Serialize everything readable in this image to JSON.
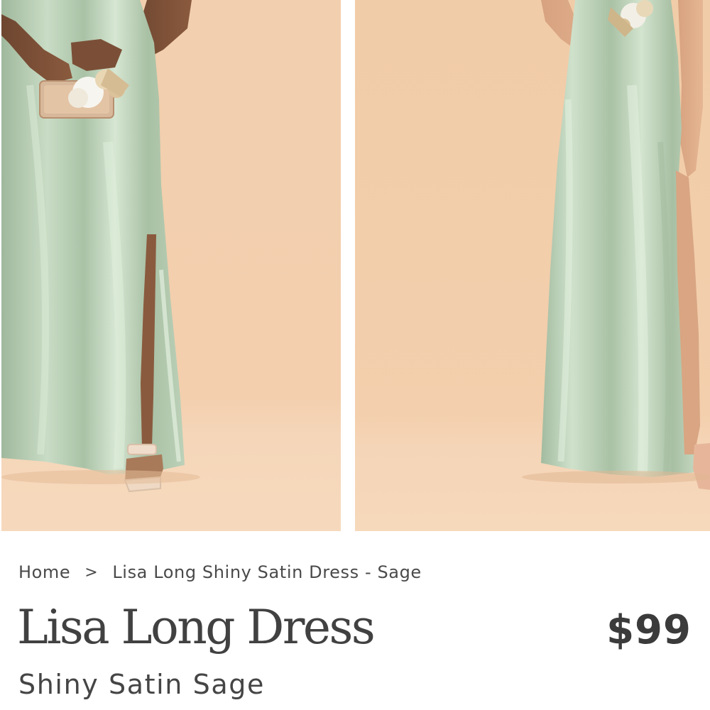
{
  "gallery": {
    "images": [
      {
        "alt": "Model wearing Lisa Long Dress in sage satin holding a clutch and flowers"
      },
      {
        "alt": "Model wearing Lisa Long Dress in sage satin with side slit"
      }
    ]
  },
  "breadcrumb": {
    "home": "Home",
    "separator": ">",
    "current": "Lisa Long Shiny Satin Dress - Sage"
  },
  "product": {
    "title": "Lisa Long Dress",
    "price": "$99",
    "variant": "Shiny Satin Sage"
  },
  "colors": {
    "backdrop": "#f3d0b0",
    "dress": "#b7cdb3",
    "text": "#414141"
  }
}
